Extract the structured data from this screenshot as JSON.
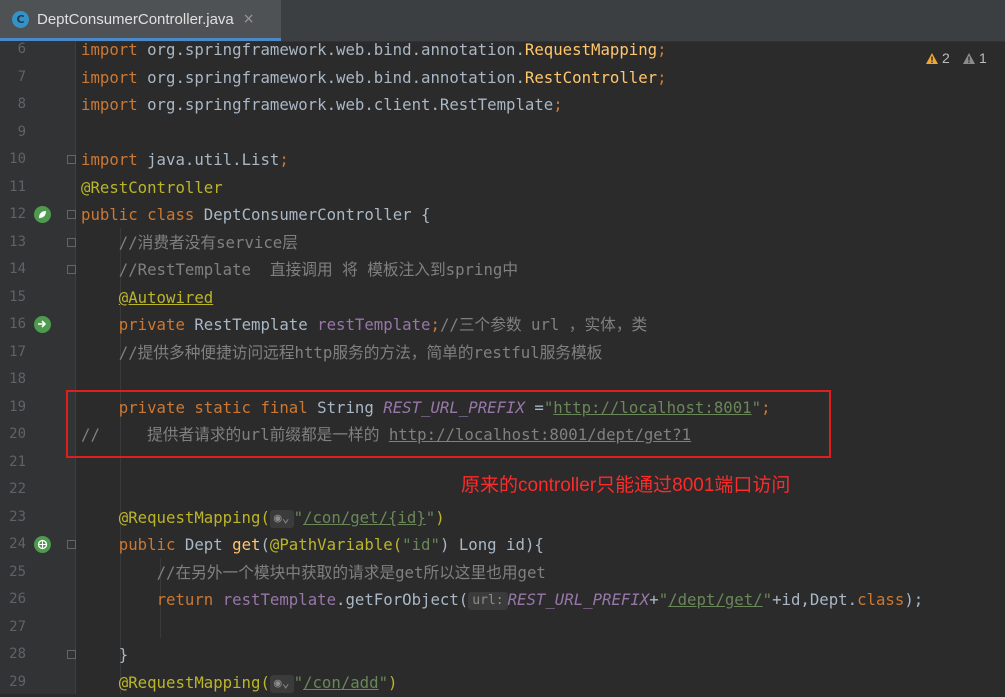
{
  "tab": {
    "icon_letter": "C",
    "title": "DeptConsumerController.java",
    "close": "×"
  },
  "markers": {
    "warnings": "2",
    "weak_warnings": "1"
  },
  "annotation_note": "原来的controller只能通过8001端口访问",
  "line_numbers": [
    "6",
    "7",
    "8",
    "9",
    "10",
    "11",
    "12",
    "13",
    "14",
    "15",
    "16",
    "17",
    "18",
    "19",
    "20",
    "21",
    "22",
    "23",
    "24",
    "25",
    "26",
    "27",
    "28",
    "29"
  ],
  "code": {
    "l6": {
      "kw": "import",
      "text": " org.springframework.web.bind.annotation.",
      "cls": "RequestMapping",
      "semi": ";"
    },
    "l7": {
      "kw": "import",
      "text": " org.springframework.web.bind.annotation.",
      "cls": "RestController",
      "semi": ";"
    },
    "l8": {
      "kw": "import",
      "text": " org.springframework.web.client.RestTemplate",
      "semi": ";"
    },
    "l10": {
      "kw": "import",
      "text": " java.util.List",
      "semi": ";"
    },
    "l11": {
      "ann": "@RestController"
    },
    "l12": {
      "kw1": "public",
      "kw2": "class",
      "text": " DeptConsumerController {"
    },
    "l13": {
      "cmt": "//消费者没有service层"
    },
    "l14": {
      "cmt": "//RestTemplate  直接调用 将 模板注入到spring中"
    },
    "l15": {
      "ann": "@Autowired"
    },
    "l16": {
      "kw": "private",
      "type": " RestTemplate ",
      "fld": "restTemplate",
      "semi": ";",
      "cmt": "//三个参数 url ，实体，类"
    },
    "l17": {
      "cmt": "//提供多种便捷访问远程http服务的方法，简单的restful服务模板"
    },
    "l19": {
      "kw": "private static final",
      "type": " String ",
      "const": "REST_URL_PREFIX",
      "eq": " =",
      "q1": "\"",
      "url": "http://localhost:8001",
      "q2": "\"",
      "semi": ";"
    },
    "l20": {
      "cmt_prefix": "//     提供者请求的url前缀都是一样的 ",
      "cmt_url": "http://localhost:8001/dept/get?1"
    },
    "l23": {
      "ann": "@RequestMapping(",
      "q1": "\"",
      "path": "/con/get/{id}",
      "q2": "\"",
      "close": ")"
    },
    "l24": {
      "kw": "public",
      "t1": " Dept ",
      "method": "get",
      "p1": "(",
      "ann": "@PathVariable(",
      "str": "\"id\"",
      "rest": ") Long id){"
    },
    "l25": {
      "cmt": "//在另外一个模块中获取的请求是get所以这里也用get"
    },
    "l26": {
      "kw": "return",
      "sp": " ",
      "fld": "restTemplate",
      "call": ".getForObject(",
      "hint": "url:",
      "const": "REST_URL_PREFIX",
      "plus": "+",
      "q1": "\"",
      "path": "/dept/get/",
      "q2": "\"",
      "rest": "+id,Dept.",
      "kw2": "class",
      "end": ");"
    },
    "l28": {
      "text": "}"
    },
    "l29": {
      "ann": "@RequestMapping(",
      "q1": "\"",
      "path": "/con/add",
      "q2": "\"",
      "close": ")"
    }
  }
}
